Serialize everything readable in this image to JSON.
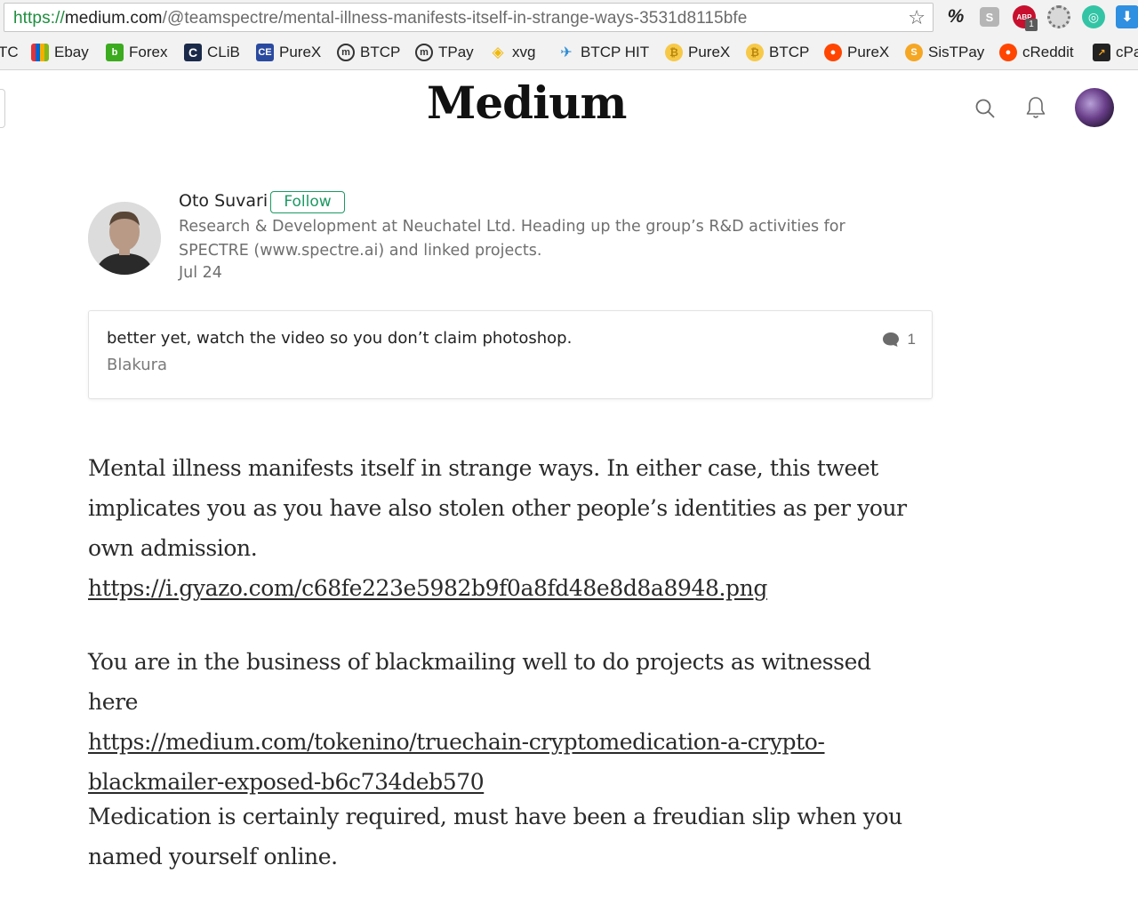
{
  "browser": {
    "url_scheme": "https://",
    "url_host": "medium.com",
    "url_path": "/@teamspectre/mental-illness-manifests-itself-in-strange-ways-3531d8115bfe",
    "star_icon": "bookmark-star-icon",
    "extensions": [
      {
        "name": "percent-extension-icon",
        "glyph": "%"
      },
      {
        "name": "s-extension-icon",
        "glyph": "S"
      },
      {
        "name": "abp-extension-icon",
        "glyph": "ABP",
        "badge": "1"
      },
      {
        "name": "film-extension-icon",
        "glyph": "🎞"
      },
      {
        "name": "circle-extension-icon",
        "glyph": "◎"
      },
      {
        "name": "download-extension-icon",
        "glyph": "⬇"
      }
    ]
  },
  "bookmarks": [
    {
      "label": "TC",
      "icon": "none"
    },
    {
      "label": "Ebay",
      "icon": "ebay-bag-icon"
    },
    {
      "label": "Forex",
      "icon": "forex-b-icon"
    },
    {
      "label": "CLiB",
      "icon": "clib-c-icon"
    },
    {
      "label": "PureX",
      "icon": "ce-icon"
    },
    {
      "label": "BTCP",
      "icon": "btcp-m-icon"
    },
    {
      "label": "TPay",
      "icon": "tpay-m-icon"
    },
    {
      "label": "xvg",
      "icon": "binance-icon"
    },
    {
      "label": "BTCP HIT",
      "icon": "bird-icon"
    },
    {
      "label": "PureX",
      "icon": "bitcoin-coin-icon"
    },
    {
      "label": "BTCP",
      "icon": "bitcoin-coin-icon"
    },
    {
      "label": "PureX",
      "icon": "reddit-icon"
    },
    {
      "label": "SisTPay",
      "icon": "coin-s-icon"
    },
    {
      "label": "cReddit",
      "icon": "reddit-icon"
    },
    {
      "label": "cPa",
      "icon": "cpa-icon"
    }
  ],
  "header": {
    "logo": "Medium",
    "search_icon": "search-icon",
    "bell_icon": "notifications-bell-icon",
    "avatar": "user-avatar"
  },
  "author": {
    "name": "Oto Suvari",
    "follow_label": "Follow",
    "bio": "Research & Development at Neuchatel Ltd. Heading up the group’s R&D activities for SPECTRE (www.spectre.ai) and linked projects.",
    "date": "Jul 24"
  },
  "highlight": {
    "text": "better yet, watch the video so you don’t claim photoshop.",
    "author": "Blakura",
    "responses": "1",
    "responses_icon": "speech-bubble-icon"
  },
  "article": {
    "p1_text": "Mental illness manifests itself in strange ways. In either case, this tweet implicates you as you have also stolen other people’s identities as per your own admission.",
    "p1_link": "https://i.gyazo.com/c68fe223e5982b9f0a8fd48e8d8a8948.png",
    "p2_text": "You are in the business of blackmailing well to do projects as witnessed here",
    "p2_link": "https://medium.com/tokenino/truechain-cryptomedication-a-crypto-blackmailer-exposed-b6c734deb570",
    "p3_text": "Medication is certainly required, must have been a freudian slip when you named yourself online."
  },
  "colors": {
    "follow_green": "#1c9963",
    "url_green": "#1e8e3e",
    "text_dark": "#2a2a2a",
    "text_muted": "#6f6f6f"
  }
}
